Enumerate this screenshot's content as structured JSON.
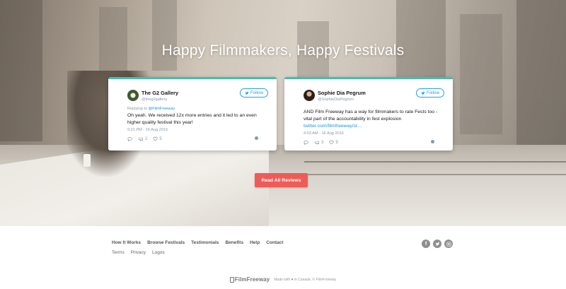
{
  "hero": {
    "title": "Happy Filmmakers, Happy Festivals",
    "cta_label": "Read All Reviews"
  },
  "tweets": [
    {
      "name": "The G2 Gallery",
      "handle": "@theg2gallery",
      "follow_label": "Follow",
      "reply_prefix": "Replying to ",
      "reply_to": "@FilmFreeway",
      "body": "Oh yeah. We received 12x more entries and it led to an even higher quality festival this year!",
      "link": "",
      "time": "9:21 PM - 16 Aug 2016",
      "retweets": "2",
      "likes": "5"
    },
    {
      "name": "Sophie Dia Pegrum",
      "handle": "@SophieDiaPegrum",
      "follow_label": "Follow",
      "reply_prefix": "",
      "reply_to": "",
      "body": "AND Film Freeway has a way for filmmakers to rate Fests too -vital part of the accountability in fest explosion",
      "link": "twitter.com/filmfreeway/st…",
      "time": "4:03 AM - 16 Aug 2016",
      "retweets": "3",
      "likes": "9"
    }
  ],
  "footer": {
    "nav": [
      "How It Works",
      "Browse Festivals",
      "Testimonials",
      "Benefits",
      "Help",
      "Contact"
    ],
    "nav2": [
      "Terms",
      "Privacy",
      "Logos"
    ],
    "social": [
      "facebook-icon",
      "twitter-icon",
      "instagram-icon"
    ],
    "logo_text": "FilmFreeway",
    "made_with_prefix": "Made with",
    "made_with_suffix": "in Canada. © FilmFreeway"
  },
  "colors": {
    "accent_teal": "#3fc1a8",
    "cta_red": "#ef5b56",
    "twitter_blue": "#1da1f2"
  }
}
